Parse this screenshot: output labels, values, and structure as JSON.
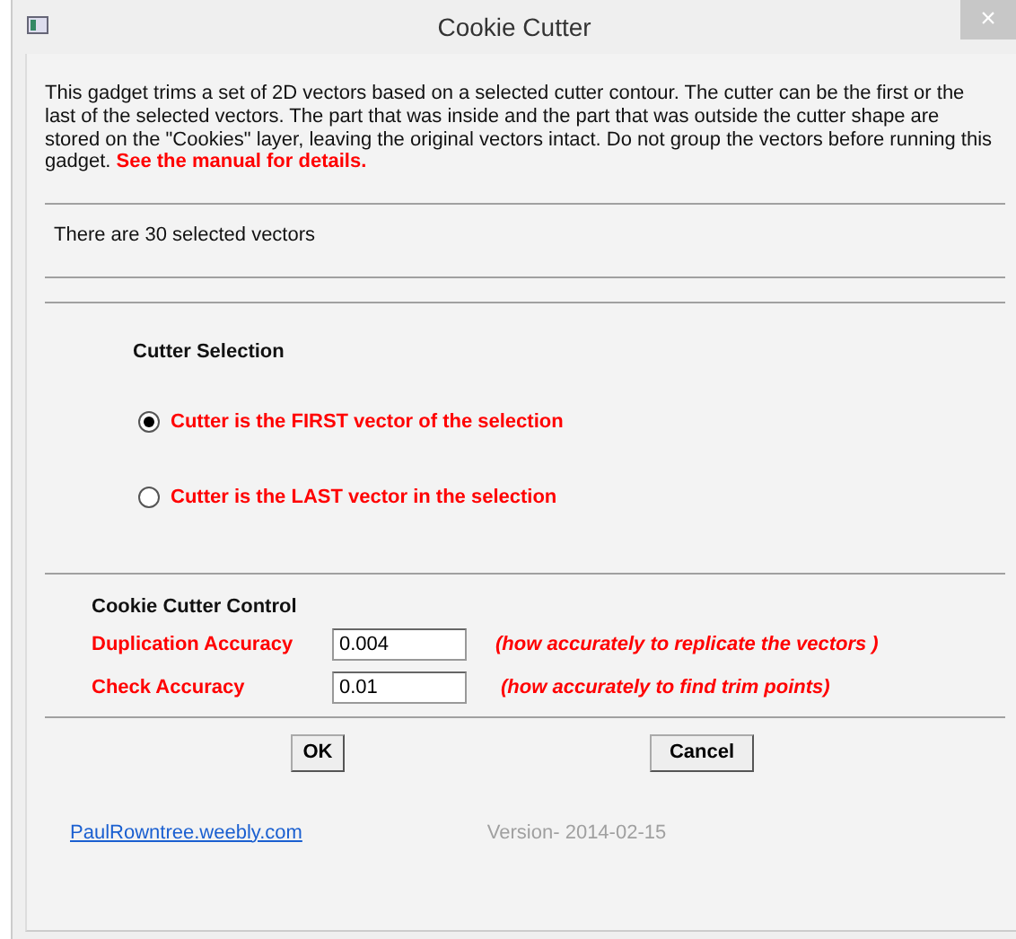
{
  "window": {
    "title": "Cookie Cutter",
    "close": "×"
  },
  "description": "This gadget trims a set of 2D vectors based on a selected cutter contour.  The cutter can be the first or the last of the selected vectors.  The part that was inside and the part that was outside the cutter shape are stored on the \"Cookies\" layer, leaving the original vectors intact.  Do not group the vectors before running this gadget.  **See the manual for details.**",
  "status": "There are 30 selected vectors",
  "cutter_selection": {
    "heading": "Cutter Selection",
    "options": [
      {
        "label": "Cutter is the FIRST vector of the selection",
        "selected": true
      },
      {
        "label": "Cutter is the LAST vector in the selection",
        "selected": false
      }
    ]
  },
  "control": {
    "heading": "Cookie Cutter Control",
    "fields": [
      {
        "label": "Duplication Accuracy",
        "value": "0.004",
        "hint": "(how accurately to replicate the vectors )"
      },
      {
        "label": "Check Accuracy",
        "value": "0.01",
        "hint": "(how accurately to find trim points)"
      }
    ]
  },
  "buttons": [
    "OK",
    "Cancel"
  ],
  "link": "PaulRowntree.weebly.com",
  "version": "Version- 2014-02-15"
}
